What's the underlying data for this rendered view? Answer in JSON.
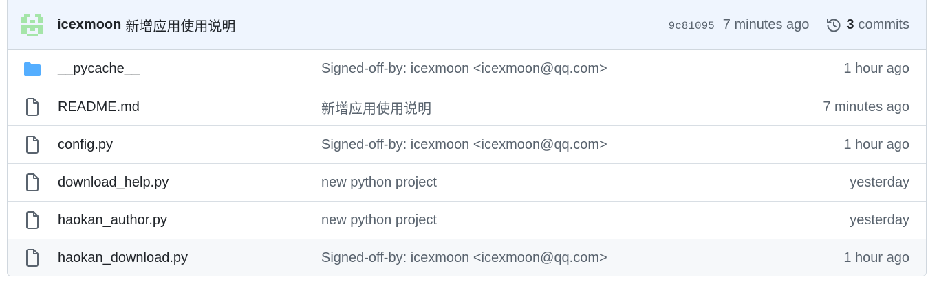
{
  "latest_commit": {
    "author": "icexmoon",
    "message": "新增应用使用说明",
    "sha": "9c81095",
    "time": "7 minutes ago",
    "commit_count": "3",
    "commits_label": "commits"
  },
  "files": [
    {
      "name": "__pycache__",
      "type": "folder",
      "commit": "Signed-off-by: icexmoon <icexmoon@qq.com>",
      "time": "1 hour ago"
    },
    {
      "name": "README.md",
      "type": "file",
      "commit": "新增应用使用说明",
      "time": "7 minutes ago"
    },
    {
      "name": "config.py",
      "type": "file",
      "commit": "Signed-off-by: icexmoon <icexmoon@qq.com>",
      "time": "1 hour ago"
    },
    {
      "name": "download_help.py",
      "type": "file",
      "commit": "new python project",
      "time": "yesterday"
    },
    {
      "name": "haokan_author.py",
      "type": "file",
      "commit": "new python project",
      "time": "yesterday"
    },
    {
      "name": "haokan_download.py",
      "type": "file",
      "commit": "Signed-off-by: icexmoon <icexmoon@qq.com>",
      "time": "1 hour ago"
    }
  ],
  "colors": {
    "header_bg": "#eff5fe",
    "folder_icon": "#54aeff",
    "avatar": "#a5e5a9",
    "muted_text": "#59636e"
  }
}
